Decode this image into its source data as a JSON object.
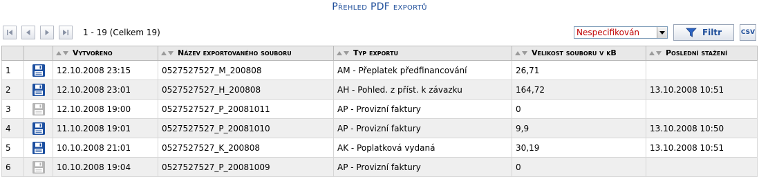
{
  "page": {
    "title": "Přehled PDF exportů"
  },
  "toolbar": {
    "paging_text": "1 - 19 (Celkem 19)",
    "filter_select_value": "Nespecifikován",
    "filter_button_label": "Filtr",
    "csv_button_label": "CSV"
  },
  "table": {
    "columns": [
      "",
      "",
      "Vytvořeno",
      "Název exportovaného souboru",
      "Typ exportu",
      "Velikost souboru v kB",
      "Poslední stažení"
    ],
    "rows": [
      {
        "index": "1",
        "download_enabled": true,
        "created": "12.10.2008 23:15",
        "name": "0527527527_M_200808",
        "type": "AM - Přeplatek předfinancování",
        "size": "26,71",
        "last_download": ""
      },
      {
        "index": "2",
        "download_enabled": true,
        "created": "12.10.2008 23:01",
        "name": "0527527527_H_200808",
        "type": "AH - Pohled. z příst. k závazku",
        "size": "164,72",
        "last_download": "13.10.2008 10:51"
      },
      {
        "index": "3",
        "download_enabled": false,
        "created": "12.10.2008 19:00",
        "name": "0527527527_P_20081011",
        "type": "AP - Provizní faktury",
        "size": "0",
        "last_download": ""
      },
      {
        "index": "4",
        "download_enabled": true,
        "created": "11.10.2008 19:01",
        "name": "0527527527_P_20081010",
        "type": "AP - Provizní faktury",
        "size": "9,9",
        "last_download": "13.10.2008 10:50"
      },
      {
        "index": "5",
        "download_enabled": true,
        "created": "10.10.2008 21:01",
        "name": "0527527527_K_200808",
        "type": "AK - Poplatková vydaná",
        "size": "30,19",
        "last_download": "13.10.2008 10:51"
      },
      {
        "index": "6",
        "download_enabled": false,
        "created": "10.10.2008 19:04",
        "name": "0527527527_P_20081009",
        "type": "AP - Provizní faktury",
        "size": "0",
        "last_download": ""
      }
    ]
  },
  "colors": {
    "title": "#1f4e9a",
    "select_text": "#c00000",
    "disk_active": "#1c4fa0",
    "disk_disabled": "#b5b5b5"
  }
}
